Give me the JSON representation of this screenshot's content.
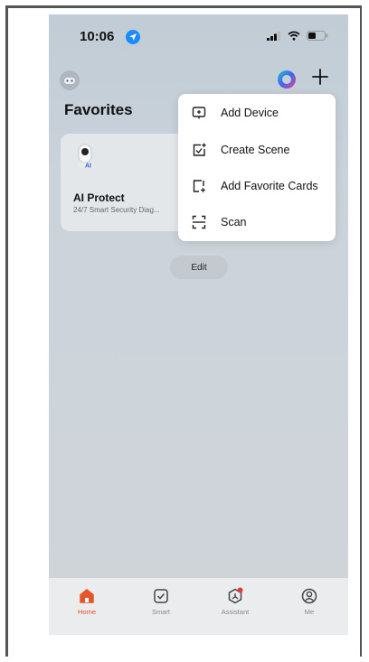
{
  "status_bar": {
    "time": "10:06"
  },
  "header": {
    "title": "Favorites"
  },
  "card": {
    "title": "AI Protect",
    "subtitle": "24/7 Smart Security Diag...",
    "icon_badge": "AI"
  },
  "edit_label": "Edit",
  "menu": {
    "items": [
      {
        "label": "Add Device",
        "icon": "add-device-icon"
      },
      {
        "label": "Create Scene",
        "icon": "create-scene-icon"
      },
      {
        "label": "Add Favorite Cards",
        "icon": "add-card-icon"
      },
      {
        "label": "Scan",
        "icon": "scan-icon"
      }
    ]
  },
  "tabbar": {
    "items": [
      {
        "label": "Home",
        "active": true
      },
      {
        "label": "Smart",
        "active": false
      },
      {
        "label": "Assistant",
        "active": false
      },
      {
        "label": "Me",
        "active": false
      }
    ]
  },
  "colors": {
    "accent": "#e8542a",
    "location_blue": "#1a8cff",
    "badge_red": "#e53935"
  }
}
